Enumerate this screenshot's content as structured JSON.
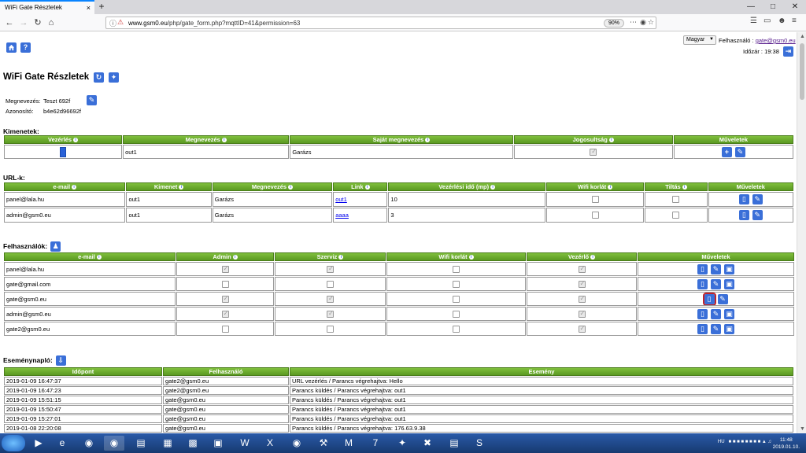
{
  "browser": {
    "tab_title": "WiFi Gate Részletek",
    "tab_close": "×",
    "new_tab": "+",
    "url_host": "www.gsm0.eu",
    "url_path": "/php/gate_form.php?mqttID=41&permission=63",
    "zoom": "90%",
    "win_min": "—",
    "win_max": "□",
    "win_close": "✕"
  },
  "header": {
    "language": "Magyar",
    "user_label": "Felhasználó :",
    "user_email": "gate@gsm0.eu",
    "time_label": "Időzár :",
    "time_value": "19:38"
  },
  "page_title": "WiFi Gate Részletek",
  "device": {
    "name_label": "Megnevezés:",
    "name_value": "Teszt 692f",
    "id_label": "Azonosító:",
    "id_value": "b4e62d96692f"
  },
  "outputs": {
    "title": "Kimenetek:",
    "columns": [
      "Vezérlés",
      "Megnevezés",
      "Saját megnevezés",
      "Jogosultság",
      "Műveletek"
    ],
    "rows": [
      {
        "name": "out1",
        "own_name": "Garázs",
        "permission": true
      }
    ]
  },
  "urls": {
    "title": "URL-k:",
    "columns": [
      "e-mail",
      "Kimenet",
      "Megnevezés",
      "Link",
      "Vezérlési idő (mp)",
      "Wifi korlát",
      "Tiltás",
      "Műveletek"
    ],
    "rows": [
      {
        "email": "panel@lala.hu",
        "output": "out1",
        "name": "Garázs",
        "link": "out1",
        "time": "10",
        "wifi": false,
        "ban": false
      },
      {
        "email": "admin@gsm0.eu",
        "output": "out1",
        "name": "Garázs",
        "link": "aaaa",
        "time": "3",
        "wifi": false,
        "ban": false
      }
    ]
  },
  "users": {
    "title": "Felhasználók:",
    "columns": [
      "e-mail",
      "Admin",
      "Szerviz",
      "Wifi korlát",
      "Vezérlő",
      "Műveletek"
    ],
    "rows": [
      {
        "email": "panel@lala.hu",
        "admin": true,
        "service": true,
        "wifi": false,
        "control": true
      },
      {
        "email": "gate@gmail.com",
        "admin": false,
        "service": false,
        "wifi": false,
        "control": true
      },
      {
        "email": "gate@gsm0.eu",
        "admin": true,
        "service": true,
        "wifi": false,
        "control": true
      },
      {
        "email": "admin@gsm0.eu",
        "admin": true,
        "service": true,
        "wifi": false,
        "control": true
      },
      {
        "email": "gate2@gsm0.eu",
        "admin": false,
        "service": false,
        "wifi": false,
        "control": true
      }
    ]
  },
  "events": {
    "title": "Eseménynapló:",
    "columns": [
      "Időpont",
      "Felhasználó",
      "Esemény"
    ],
    "rows": [
      {
        "time": "2019-01-09 16:47:37",
        "user": "gate2@gsm0.eu",
        "event": "URL vezérlés / Parancs végrehajtva: Hello"
      },
      {
        "time": "2019-01-09 16:47:23",
        "user": "gate2@gsm0.eu",
        "event": "Parancs küldés / Parancs végrehajtva: out1"
      },
      {
        "time": "2019-01-09 15:51:15",
        "user": "gate@gsm0.eu",
        "event": "Parancs küldés / Parancs végrehajtva: out1"
      },
      {
        "time": "2019-01-09 15:50:47",
        "user": "gate@gsm0.eu",
        "event": "Parancs küldés / Parancs végrehajtva: out1"
      },
      {
        "time": "2019-01-09 15:27:01",
        "user": "gate@gsm0.eu",
        "event": "Parancs küldés / Parancs végrehajtva: out1"
      },
      {
        "time": "2019-01-08 22:20:08",
        "user": "gate@gsm0.eu",
        "event": "Parancs küldés / Parancs végrehajtva: 176.63.9.38"
      }
    ]
  },
  "taskbar": {
    "lang": "HU",
    "time": "11:48",
    "date": "2019.01.10."
  },
  "colors": {
    "header_green": "#67a629",
    "button_blue": "#3a6fd8",
    "selected_red": "#c0232b"
  }
}
